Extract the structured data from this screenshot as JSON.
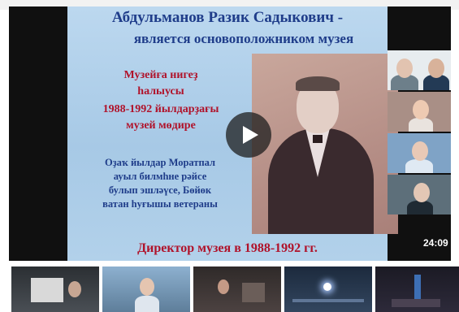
{
  "slide": {
    "title": "Абдульманов Разик Садыкович  -",
    "subtitle": "является основоположником  музея",
    "bashkir_lines": [
      "Музейға нигеҙ",
      "һалыусы",
      "1988-1992 йылдарҙағы",
      "музей мөдире"
    ],
    "description_lines": [
      "Оҙаҡ йылдар Моратпал",
      "ауыл билмһне рәйсе",
      "булып эшләүсе, Бөйөк",
      "ватан һуғышы ветераны"
    ],
    "footer": "Директор музея в 1988-1992 гг."
  },
  "player": {
    "duration": "24:09",
    "play_icon": "play-icon"
  },
  "participants_count": 5,
  "thumbnails_count": 5
}
